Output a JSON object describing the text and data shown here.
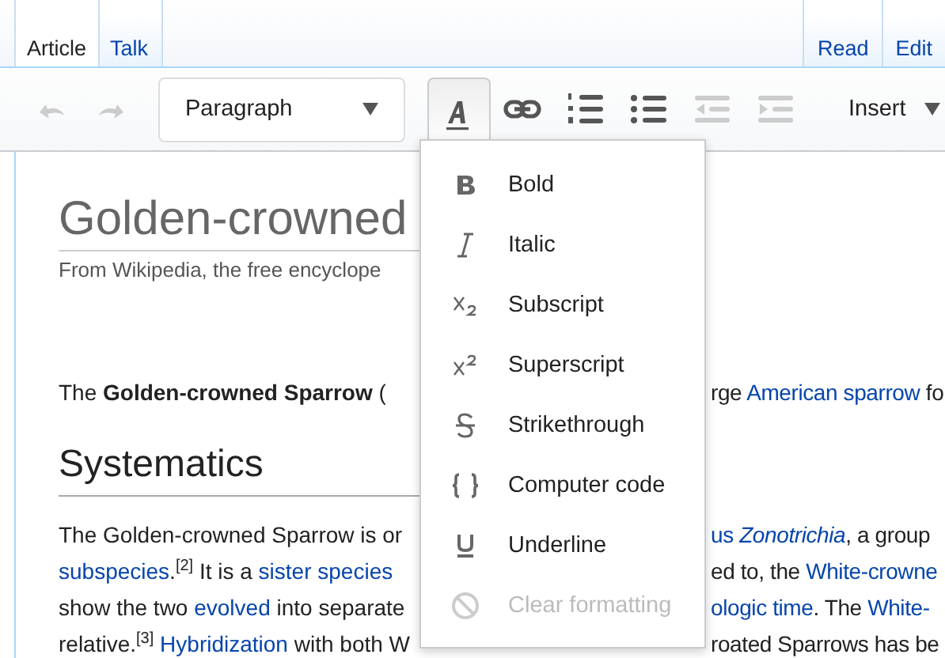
{
  "tabs_left": [
    {
      "label": "Article",
      "selected": true
    },
    {
      "label": "Talk",
      "selected": false
    }
  ],
  "tabs_right": [
    {
      "label": "Read",
      "selected": false
    },
    {
      "label": "Edit",
      "selected": false
    }
  ],
  "toolbar": {
    "history": [
      {
        "kind": "undo",
        "disabled": true
      },
      {
        "kind": "redo",
        "disabled": true
      }
    ],
    "format_dropdown": {
      "label": "Paragraph"
    },
    "style_button": {
      "expanded": true
    },
    "tools": [
      {
        "kind": "link",
        "disabled": false
      },
      {
        "kind": "numbered-list",
        "disabled": false
      },
      {
        "kind": "bullet-list",
        "disabled": false
      },
      {
        "kind": "outdent",
        "disabled": true
      },
      {
        "kind": "indent",
        "disabled": true
      }
    ],
    "insert_dropdown": {
      "label": "Insert"
    }
  },
  "article": {
    "title": "Golden-crowned",
    "tagline": "From Wikipedia, the free encyclope",
    "lead": {
      "left": [
        {
          "text": "The **Golden-crowned Sparrow** (",
          "link": false
        }
      ],
      "right": [
        {
          "text": "rge ",
          "link": false
        },
        {
          "text": "American sparrow",
          "link": true
        },
        {
          "text": " fo",
          "link": false
        }
      ]
    },
    "section_heading": "Systematics",
    "lines": [
      {
        "left": [
          {
            "text": "The Golden-crowned Sparrow is or",
            "link": false
          }
        ],
        "right": [
          {
            "text": "us *Zonotrichia*",
            "link": true
          },
          {
            "text": ", a group",
            "link": false
          }
        ]
      },
      {
        "left": [
          {
            "text": "subspecies",
            "link": true
          },
          {
            "text": ".$^{[2]}$ It is a ",
            "link": false
          },
          {
            "text": "sister species",
            "link": true
          }
        ],
        "right": [
          {
            "text": "ed to, the ",
            "link": false
          },
          {
            "text": "White-crowne",
            "link": true
          }
        ]
      },
      {
        "left": [
          {
            "text": "show the two ",
            "link": false
          },
          {
            "text": "evolved",
            "link": true
          },
          {
            "text": " into separate",
            "link": false
          }
        ],
        "right": [
          {
            "text": "ologic time",
            "link": true
          },
          {
            "text": ".  The ",
            "link": false
          },
          {
            "text": "White-",
            "link": true
          }
        ]
      },
      {
        "left": [
          {
            "text": "relative.$^{[3]}$ ",
            "link": false
          },
          {
            "text": "Hybridization",
            "link": true
          },
          {
            "text": " with both W",
            "link": false
          }
        ],
        "right": [
          {
            "text": "roated Sparrows has be",
            "link": false
          }
        ]
      }
    ]
  },
  "style_menu": {
    "items": [
      {
        "kind": "bold",
        "label": "Bold",
        "disabled": false
      },
      {
        "kind": "italic",
        "label": "Italic",
        "disabled": false
      },
      {
        "kind": "subscript",
        "label": "Subscript",
        "disabled": false
      },
      {
        "kind": "superscript",
        "label": "Superscript",
        "disabled": false
      },
      {
        "kind": "strikethrough",
        "label": "Strikethrough",
        "disabled": false
      },
      {
        "kind": "code",
        "label": "Computer code",
        "disabled": false
      },
      {
        "kind": "underline",
        "label": "Underline",
        "disabled": false
      },
      {
        "kind": "clear",
        "label": "Clear formatting",
        "disabled": true
      }
    ]
  }
}
